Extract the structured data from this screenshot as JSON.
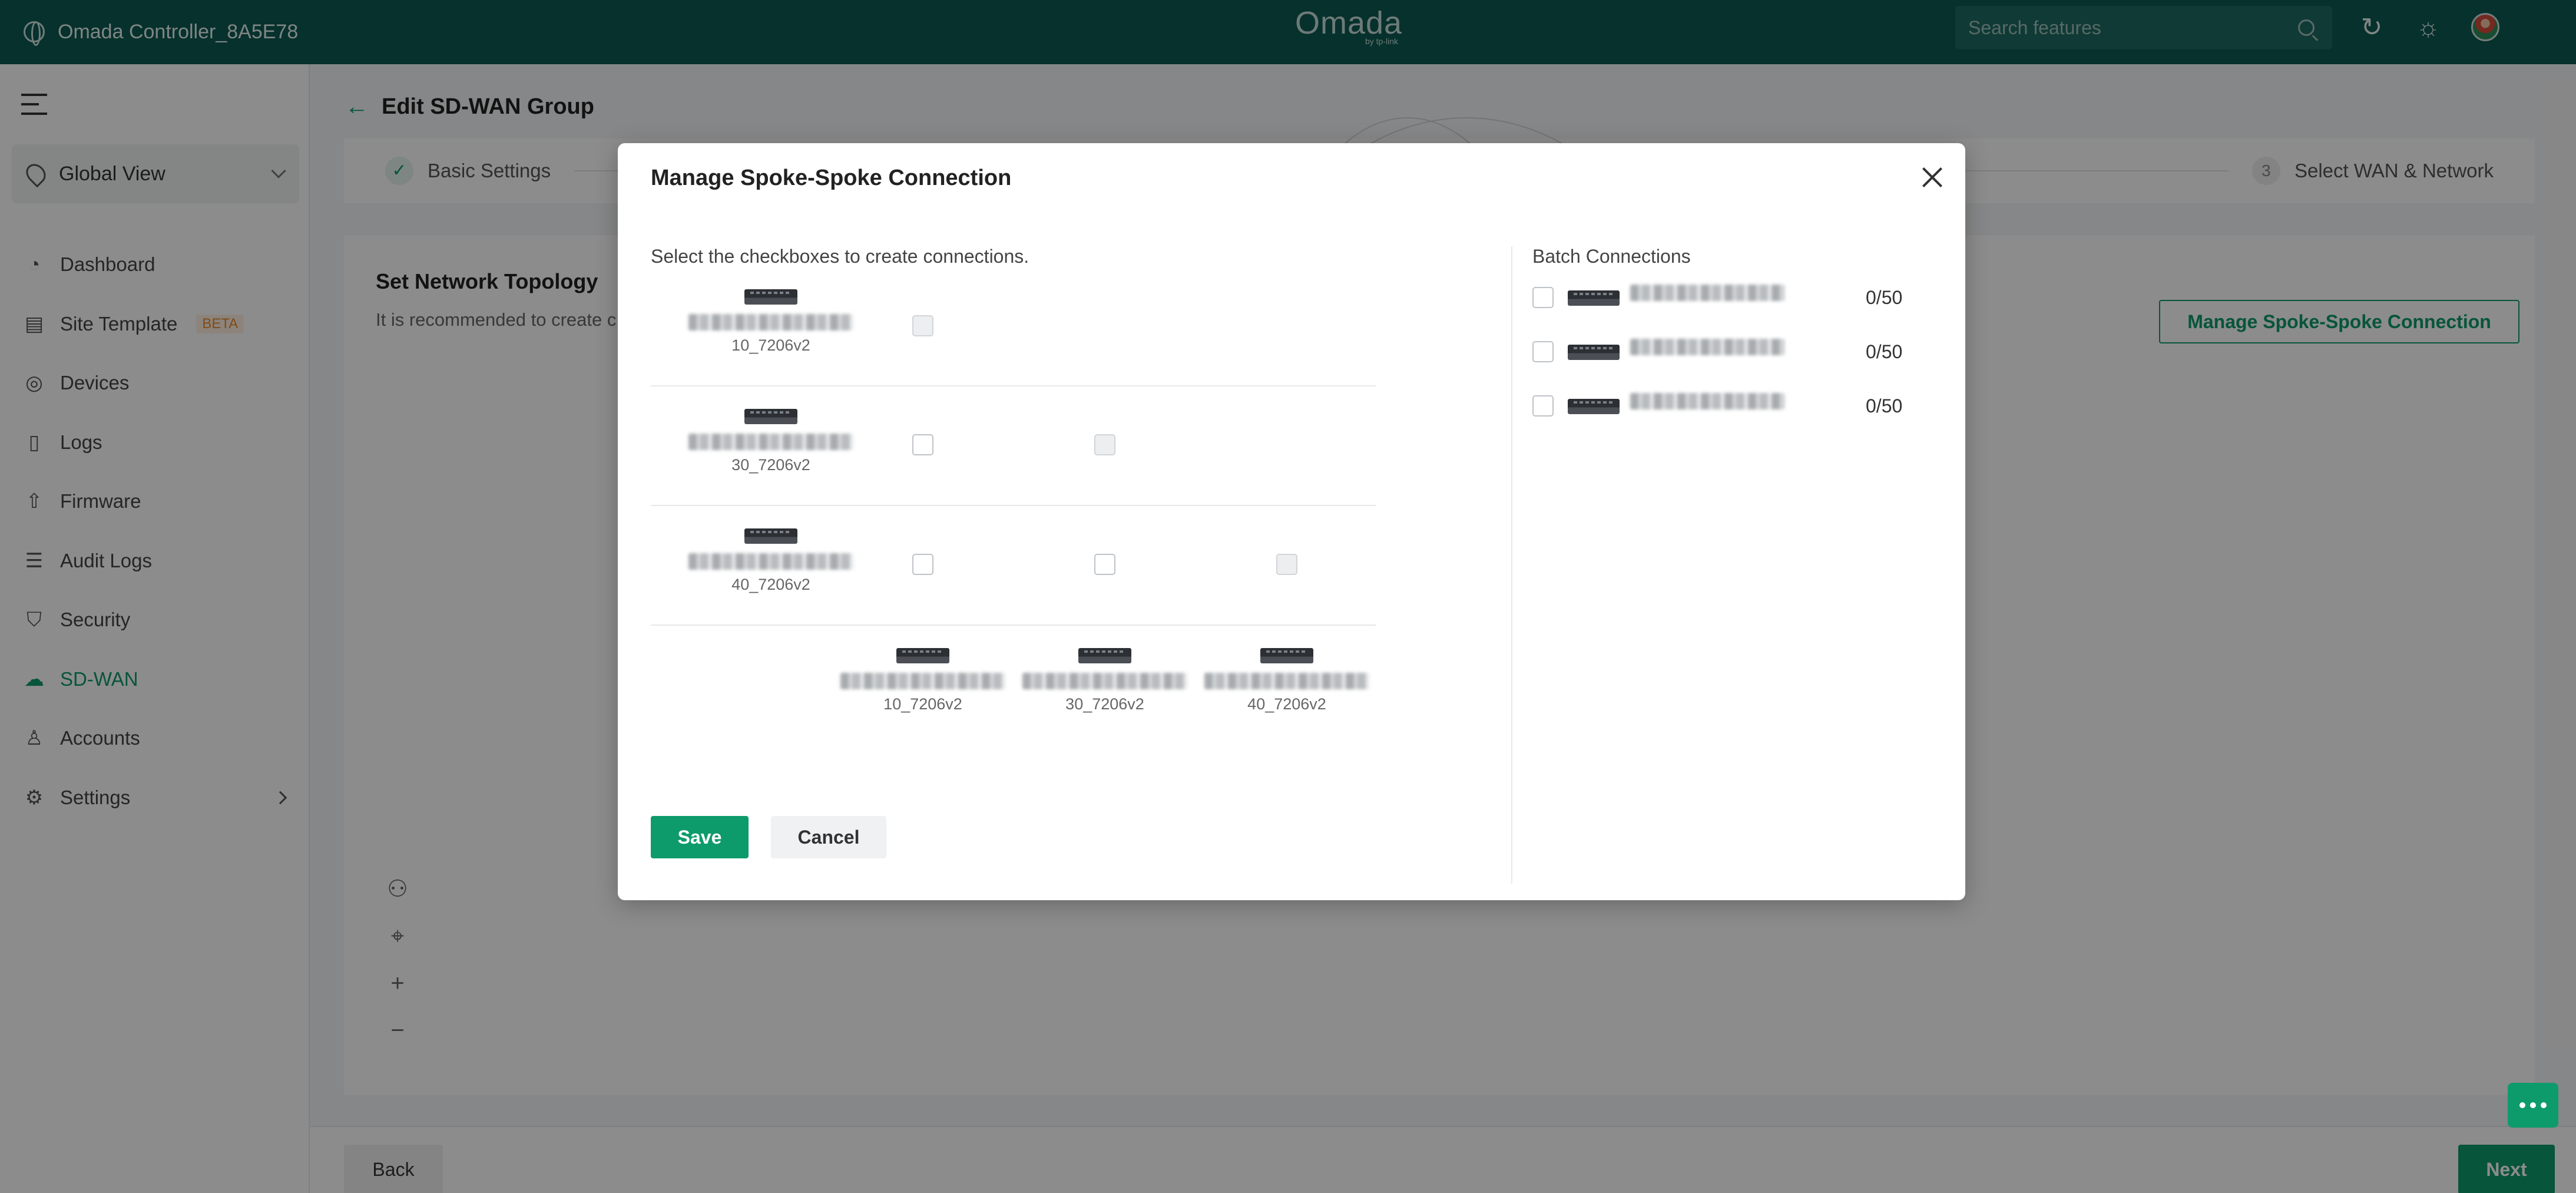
{
  "topbar": {
    "controller_name": "Omada Controller_8A5E78",
    "logo_text": "Omada",
    "logo_sub": "by tp-link",
    "search_placeholder": "Search features"
  },
  "sidebar": {
    "global_view": "Global View",
    "items": [
      {
        "label": "Dashboard",
        "icon": "dashboard-icon"
      },
      {
        "label": "Site Template",
        "icon": "template-icon",
        "badge": "BETA"
      },
      {
        "label": "Devices",
        "icon": "devices-icon"
      },
      {
        "label": "Logs",
        "icon": "logs-icon"
      },
      {
        "label": "Firmware",
        "icon": "firmware-icon"
      },
      {
        "label": "Audit Logs",
        "icon": "audit-logs-icon"
      },
      {
        "label": "Security",
        "icon": "shield-icon"
      },
      {
        "label": "SD-WAN",
        "icon": "cloud-icon",
        "active": true
      },
      {
        "label": "Accounts",
        "icon": "user-icon"
      },
      {
        "label": "Settings",
        "icon": "gear-icon"
      }
    ]
  },
  "page": {
    "title": "Edit SD-WAN Group",
    "step1": "Basic Settings",
    "step3_number": "3",
    "step3": "Select WAN & Network",
    "section_title": "Set Network Topology",
    "hint": "It is recommended to create c",
    "manage_button": "Manage Spoke-Spoke Connection",
    "back_button": "Back",
    "next_button": "Next"
  },
  "modal": {
    "title": "Manage Spoke-Spoke Connection",
    "instruction": "Select the checkboxes to create connections.",
    "row_devices": [
      "10_7206v2",
      "30_7206v2",
      "40_7206v2"
    ],
    "col_devices": [
      "10_7206v2",
      "30_7206v2",
      "40_7206v2"
    ],
    "batch_title": "Batch Connections",
    "batch_counts": [
      "0/50",
      "0/50",
      "0/50"
    ],
    "save": "Save",
    "cancel": "Cancel"
  },
  "colors": {
    "topbar": "#0b5a50",
    "accent": "#0e9b6c"
  }
}
